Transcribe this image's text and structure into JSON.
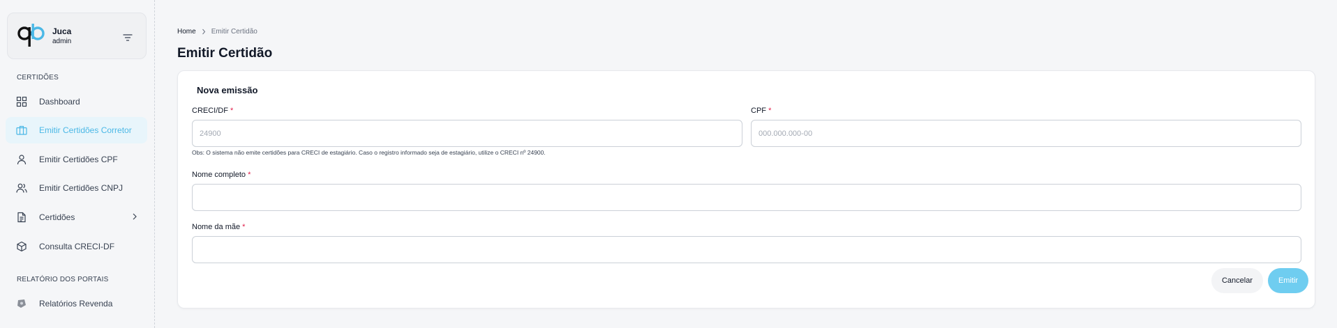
{
  "user": {
    "name": "Juca",
    "role": "admin"
  },
  "sidebar": {
    "section1": "CERTIDÕES",
    "items": [
      {
        "label": "Dashboard",
        "icon": "grid-icon"
      },
      {
        "label": "Emitir Certidões Corretor",
        "icon": "briefcase-icon",
        "active": true
      },
      {
        "label": "Emitir Certidões CPF",
        "icon": "user-icon"
      },
      {
        "label": "Emitir Certidões CNPJ",
        "icon": "users-icon"
      },
      {
        "label": "Certidões",
        "icon": "document-icon"
      },
      {
        "label": "Consulta CRECI-DF",
        "icon": "cube-icon"
      }
    ],
    "section2": "RELATÓRIO DOS PORTAIS",
    "items2": [
      {
        "label": "Relatórios Revenda",
        "icon": "portal-logo-icon"
      }
    ]
  },
  "breadcrumb": {
    "home": "Home",
    "current": "Emitir Certidão"
  },
  "page": {
    "title": "Emitir Certidão"
  },
  "form": {
    "title": "Nova emissão",
    "creci_label": "CRECI/DF",
    "creci_placeholder": "24900",
    "cpf_label": "CPF",
    "cpf_placeholder": "000.000.000-00",
    "obs": "Obs: O sistema não emite certidões para CRECI de estagiário. Caso o registro informado seja de estagiário, utilize o CRECI nº 24900.",
    "nome_label": "Nome completo",
    "mae_label": "Nome da mãe",
    "required_mark": "*",
    "cancel": "Cancelar",
    "submit": "Emitir"
  },
  "colors": {
    "accent": "#4bb8e6",
    "button": "#6fcdf0",
    "required": "#e11d48"
  }
}
